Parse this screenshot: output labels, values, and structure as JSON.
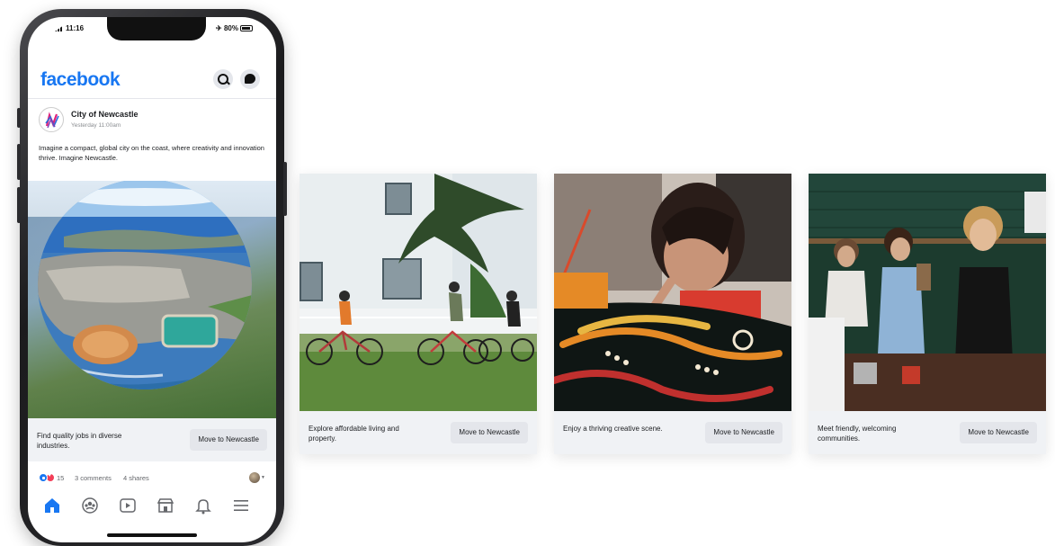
{
  "status_bar": {
    "time": "11:16",
    "battery": "80%"
  },
  "app": {
    "logo": "facebook",
    "icons": [
      "search-icon",
      "messenger-icon"
    ]
  },
  "post": {
    "page_name": "City of Newcastle",
    "timestamp": "Yesterday 11:00am",
    "text": "Imagine a compact, global city on the coast, where creativity and innovation thrive. Imagine Newcastle.",
    "reactions_count": "15",
    "comments": "3 comments",
    "shares": "4 shares"
  },
  "cards": [
    {
      "caption": "Find quality jobs in diverse industries.",
      "button": "Move to Newcastle"
    },
    {
      "caption": "Explore affordable living and property.",
      "button": "Move to Newcastle"
    },
    {
      "caption": "Enjoy a thriving creative scene.",
      "button": "Move to Newcastle"
    },
    {
      "caption": "Meet friendly, welcoming communities.",
      "button": "Move to Newcastle"
    }
  ],
  "tabbar": [
    "home-icon",
    "groups-icon",
    "video-icon",
    "marketplace-icon",
    "notifications-icon",
    "menu-icon"
  ],
  "colors": {
    "facebook_blue": "#1877f2",
    "footer_gray": "#f0f2f5",
    "button_gray": "#e4e6eb"
  }
}
